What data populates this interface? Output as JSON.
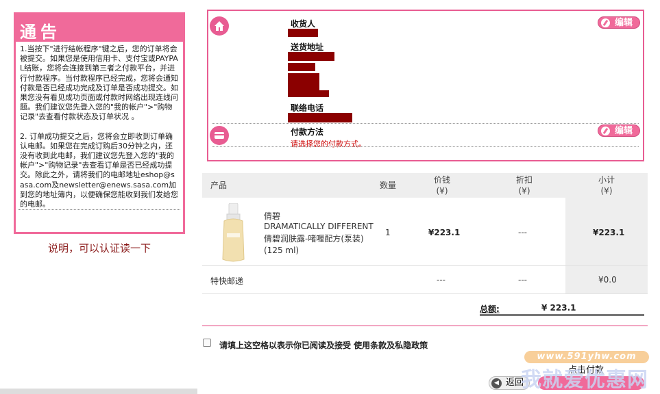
{
  "notice": {
    "title": "通告",
    "paragraph1": "1.当按下\"进行结帐程序\"键之后，您的订单将会被提交。如果您是使用信用卡、支付宝或PAYPAL结账，您将会连接到第三者之付款平台，并进行付款程序。当付款程序已经完成，您将会通知付款是否已经成功完成及订单是否成功提交。如果您没有看见成功页面或付款时网络出现连线问题。我们建议您先登入您的\"我的帐户\">\"购物记录\"去查看付款状态及订单状况 。",
    "paragraph2": "2. 订单成功提交之后，您将会立即收到订单确认电邮。如果您在完成订购后30分钟之内，还没有收到此电邮，我们建议您先登入您的\"我的帐户\">\"购物记录\"去查看订单是否已经成功提交。除此之外，请将我们的电邮地址eshop@sasa.com及newsletter@enews.sasa.com加到您的地址簿内，以便确保您能收到我们发给您的电邮。"
  },
  "explain": "说明，可以认证读一下",
  "address": {
    "receiver_label": "收货人",
    "delivery_label": "送货地址",
    "phone_label": "联络电话",
    "edit_label": "编辑"
  },
  "payment": {
    "label": "付款方法",
    "hint": "请选择您的付款方式。",
    "edit_label": "编辑"
  },
  "table": {
    "headers": {
      "product": "产品",
      "qty": "数量",
      "price": "价钱",
      "discount": "折扣",
      "subtotal": "小计",
      "currency": "(¥)"
    },
    "item": {
      "brand": "倩碧",
      "name_en": "DRAMATICALLY DIFFERENT",
      "name_cn": "倩碧润肤露-啫喱配方(泵装) (125 ml)",
      "qty": "1",
      "price": "¥223.1",
      "discount": "---",
      "subtotal": "¥223.1"
    },
    "shipping": {
      "label": "特快邮递",
      "price": "---",
      "discount": "---",
      "subtotal": "¥0.0"
    }
  },
  "total": {
    "label": "总额:",
    "value": "¥ 223.1"
  },
  "agree_text": "请填上这空格以表示你已阅读及接受 使用条款及私隐政策",
  "watermark": {
    "url": "www.591yhw.com",
    "logo": "我就爱优惠网"
  },
  "click_pay": "点击付款",
  "back_label": "返回",
  "colors": {
    "accent": "#f06a9a",
    "redact": "#8b0000",
    "hint": "#cc0000"
  }
}
